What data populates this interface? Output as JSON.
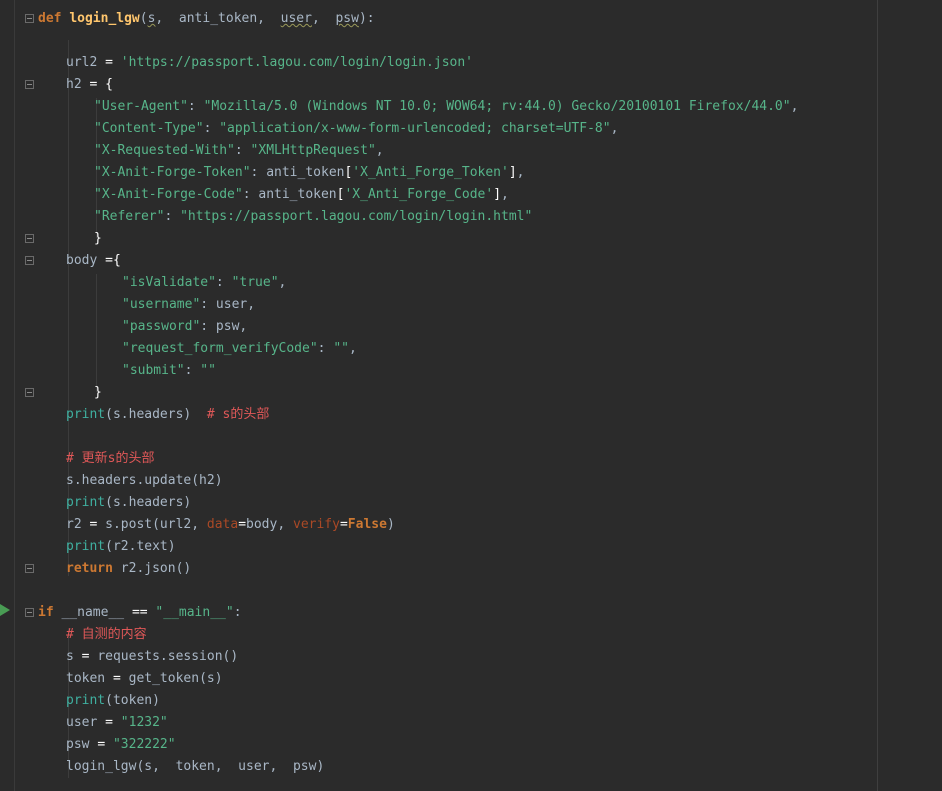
{
  "editor": {
    "theme_colors": {
      "background": "#2b2b2b",
      "keyword": "#cc7832",
      "function_name": "#ffc66d",
      "string": "#57b58a",
      "comment": "#e05858",
      "plain": "#a9b7c6"
    },
    "lines": [
      {
        "parts": [
          [
            "kw",
            "def "
          ],
          [
            "fn",
            "login_lgw"
          ],
          [
            "p",
            "("
          ],
          [
            "sq",
            "s"
          ],
          [
            "p",
            ",  anti_token,  "
          ],
          [
            "sq",
            "user"
          ],
          [
            "p",
            ",  "
          ],
          [
            "sq",
            "psw"
          ],
          [
            "p",
            "):"
          ]
        ]
      },
      {
        "parts": [
          [
            "p",
            "url2 "
          ],
          [
            "op",
            "= "
          ],
          [
            "str",
            "'https://passport.lagou.com/login/login.json'"
          ]
        ]
      },
      {
        "parts": [
          [
            "p",
            "h2 "
          ],
          [
            "op",
            "= "
          ],
          [
            "op",
            "{"
          ]
        ]
      },
      {
        "parts": [
          [
            "str",
            "\"User-Agent\""
          ],
          [
            "p",
            ": "
          ],
          [
            "str",
            "\"Mozilla/5.0 (Windows NT 10.0; WOW64; rv:44.0) Gecko/20100101 Firefox/44.0\""
          ],
          [
            "p",
            ","
          ]
        ]
      },
      {
        "parts": [
          [
            "str",
            "\"Content-Type\""
          ],
          [
            "p",
            ": "
          ],
          [
            "str",
            "\"application/x-www-form-urlencoded; charset=UTF-8\""
          ],
          [
            "p",
            ","
          ]
        ]
      },
      {
        "parts": [
          [
            "str",
            "\"X-Requested-With\""
          ],
          [
            "p",
            ": "
          ],
          [
            "str",
            "\"XMLHttpRequest\""
          ],
          [
            "p",
            ","
          ]
        ]
      },
      {
        "parts": [
          [
            "str",
            "\"X-Anit-Forge-Token\""
          ],
          [
            "p",
            ": anti_token"
          ],
          [
            "op",
            "["
          ],
          [
            "str",
            "'X_Anti_Forge_Token'"
          ],
          [
            "op",
            "]"
          ],
          [
            "p",
            ","
          ]
        ]
      },
      {
        "parts": [
          [
            "str",
            "\"X-Anit-Forge-Code\""
          ],
          [
            "p",
            ": anti_token"
          ],
          [
            "op",
            "["
          ],
          [
            "str",
            "'X_Anti_Forge_Code'"
          ],
          [
            "op",
            "]"
          ],
          [
            "p",
            ","
          ]
        ]
      },
      {
        "parts": [
          [
            "str",
            "\"Referer\""
          ],
          [
            "p",
            ": "
          ],
          [
            "str",
            "\"https://passport.lagou.com/login/login.html\""
          ]
        ]
      },
      {
        "parts": [
          [
            "op",
            "}"
          ]
        ]
      },
      {
        "parts": [
          [
            "p",
            "body "
          ],
          [
            "op",
            "={"
          ]
        ]
      },
      {
        "parts": [
          [
            "str",
            "\"isValidate\""
          ],
          [
            "p",
            ": "
          ],
          [
            "str",
            "\"true\""
          ],
          [
            "p",
            ","
          ]
        ]
      },
      {
        "parts": [
          [
            "str",
            "\"username\""
          ],
          [
            "p",
            ": user,"
          ]
        ]
      },
      {
        "parts": [
          [
            "str",
            "\"password\""
          ],
          [
            "p",
            ": psw,"
          ]
        ]
      },
      {
        "parts": [
          [
            "str",
            "\"request_form_verifyCode\""
          ],
          [
            "p",
            ": "
          ],
          [
            "str",
            "\"\""
          ],
          [
            "p",
            ","
          ]
        ]
      },
      {
        "parts": [
          [
            "str",
            "\"submit\""
          ],
          [
            "p",
            ": "
          ],
          [
            "str",
            "\"\""
          ]
        ]
      },
      {
        "parts": [
          [
            "op",
            "}"
          ]
        ]
      },
      {
        "parts": [
          [
            "bi",
            "print"
          ],
          [
            "p",
            "(s.headers)  "
          ],
          [
            "cm",
            "# s的头部"
          ]
        ]
      },
      {
        "parts": [
          [
            "cm",
            "# 更新s的头部"
          ]
        ]
      },
      {
        "parts": [
          [
            "p",
            "s.headers.update(h2)"
          ]
        ]
      },
      {
        "parts": [
          [
            "bi",
            "print"
          ],
          [
            "p",
            "(s.headers)"
          ]
        ]
      },
      {
        "parts": [
          [
            "p",
            "r2 "
          ],
          [
            "op",
            "= "
          ],
          [
            "p",
            "s.post(url2, "
          ],
          [
            "param",
            "data"
          ],
          [
            "op",
            "="
          ],
          [
            "p",
            "body, "
          ],
          [
            "param",
            "verify"
          ],
          [
            "op",
            "="
          ],
          [
            "kw",
            "False"
          ],
          [
            "p",
            ")"
          ]
        ]
      },
      {
        "parts": [
          [
            "bi",
            "print"
          ],
          [
            "p",
            "(r2.text)"
          ]
        ]
      },
      {
        "parts": [
          [
            "kw",
            "return "
          ],
          [
            "p",
            "r2.json()"
          ]
        ]
      },
      {
        "parts": [
          [
            "kw",
            "if "
          ],
          [
            "p",
            "__name__ "
          ],
          [
            "op",
            "== "
          ],
          [
            "str",
            "\"__main__\""
          ],
          [
            "p",
            ":"
          ]
        ]
      },
      {
        "parts": [
          [
            "cm",
            "# 自测的内容"
          ]
        ]
      },
      {
        "parts": [
          [
            "p",
            "s "
          ],
          [
            "op",
            "= "
          ],
          [
            "p",
            "requests.session()"
          ]
        ]
      },
      {
        "parts": [
          [
            "p",
            "token "
          ],
          [
            "op",
            "= "
          ],
          [
            "p",
            "get_token(s)"
          ]
        ]
      },
      {
        "parts": [
          [
            "bi",
            "print"
          ],
          [
            "p",
            "(token)"
          ]
        ]
      },
      {
        "parts": [
          [
            "p",
            "user "
          ],
          [
            "op",
            "= "
          ],
          [
            "str",
            "\"1232\""
          ]
        ]
      },
      {
        "parts": [
          [
            "p",
            "psw "
          ],
          [
            "op",
            "= "
          ],
          [
            "str",
            "\"322222\""
          ]
        ]
      },
      {
        "parts": [
          [
            "p",
            "login_lgw(s,  token,  user,  psw)"
          ]
        ]
      }
    ],
    "gutter_icons": [
      "fold-marker-icon",
      "run-arrow-icon"
    ]
  }
}
